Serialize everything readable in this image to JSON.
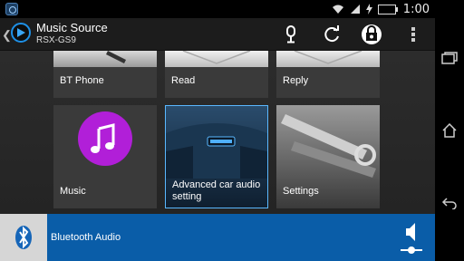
{
  "status_bar": {
    "time": "1:00",
    "icons": [
      "app-notification-icon",
      "wifi-icon",
      "signal-icon",
      "charging-icon",
      "battery-icon"
    ]
  },
  "action_bar": {
    "title": "Music Source",
    "subtitle": "RSX-GS9",
    "icons": [
      "microphone-icon",
      "refresh-icon",
      "speaker-lock-icon",
      "overflow-menu-icon"
    ]
  },
  "tiles": [
    {
      "label": "BT Phone"
    },
    {
      "label": "Read"
    },
    {
      "label": "Reply"
    },
    {
      "label": "Music"
    },
    {
      "label": "Advanced car audio setting",
      "selected": true
    },
    {
      "label": "Settings"
    }
  ],
  "bottom_bar": {
    "label": "Bluetooth Audio",
    "color": "#0a5da8"
  },
  "colors": {
    "accent": "#1e90e6",
    "music_purple": "#b11fd8",
    "selected_border": "#5ab8ff"
  }
}
